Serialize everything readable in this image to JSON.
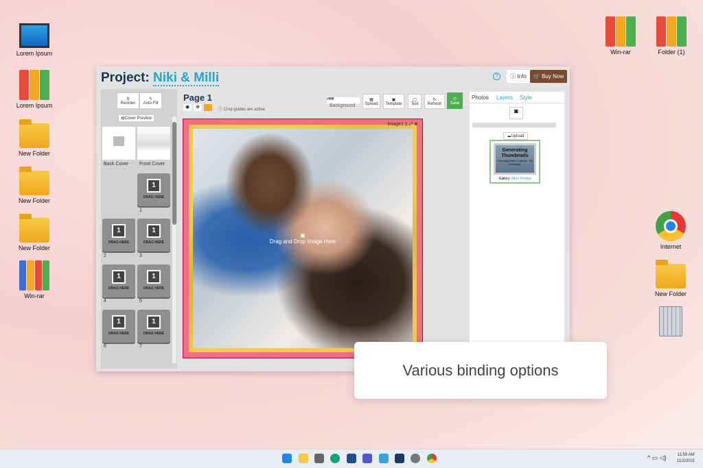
{
  "desktop": {
    "left_icons": [
      "Lorem Ipsum",
      "Lorem Ipsum",
      "New Folder",
      "New Folder",
      "New Folder",
      "Win-rar"
    ],
    "right_icons": [
      "Win-rar",
      "Folder (1)",
      "Internet",
      "New Folder"
    ]
  },
  "app": {
    "project_label": "Project:",
    "project_name": "Niki & Milli",
    "info": "Info",
    "buy_now": "Buy Now",
    "reorder": "Reorder",
    "auto_fill": "Auto Fill",
    "cover_preview": "Cover Preview",
    "back_cover": "Back Cover",
    "front_cover": "Front Cover",
    "drag_here": "DRAG HERE",
    "image_count": "1",
    "page_numbers": [
      "1",
      "2",
      "3",
      "4",
      "5",
      "6",
      "7"
    ],
    "page_title": "Page 1",
    "crop_note": "Crop guides are active.",
    "bg_value": "#ffffff",
    "background": "Background",
    "toolbar": [
      "Spread",
      "Template",
      "Text",
      "Refresh",
      "Save"
    ],
    "image_label": "Image1",
    "drop_text": "Drag and Drop Image Here",
    "tabs": [
      "Photos",
      "Layers",
      "Style"
    ],
    "upload": "Upload",
    "gen_title": "Generating Thumbnails",
    "gen_sub": "This might take a minute. Try reloading.",
    "gallery_label": "Gallery:",
    "gallery_name": "Mia's Photos"
  },
  "caption": "Various binding options",
  "taskbar": {
    "time": "11:59 AM",
    "date": "11/2/2021"
  },
  "colors": {
    "accent": "#27a3c9",
    "buy": "#7a4a2e",
    "save": "#4cb050"
  }
}
